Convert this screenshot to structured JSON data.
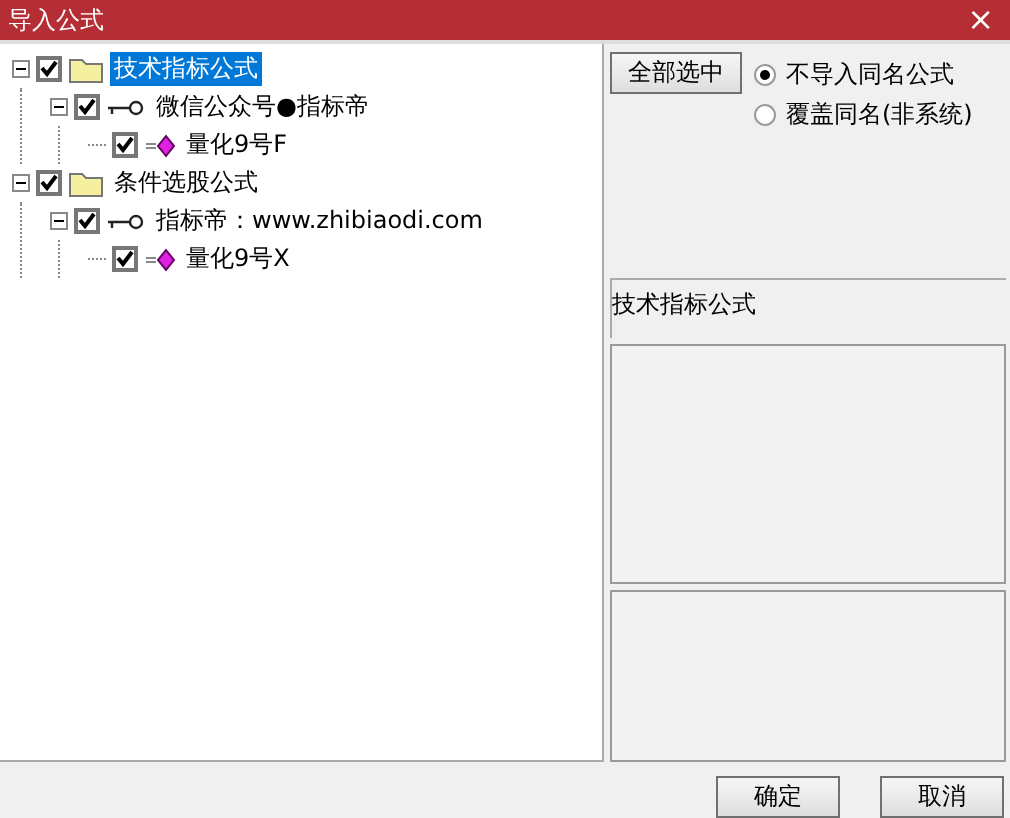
{
  "window": {
    "title": "导入公式",
    "close": "×"
  },
  "tree": [
    {
      "label": "技术指标公式",
      "kind": "folder",
      "checked": true,
      "selected": true,
      "expanded": true,
      "children": [
        {
          "label": "微信公众号●指标帝",
          "kind": "key",
          "checked": true,
          "selected": false,
          "expanded": true,
          "children": [
            {
              "label": "量化9号F",
              "kind": "formula",
              "checked": true,
              "selected": false
            }
          ]
        }
      ]
    },
    {
      "label": "条件选股公式",
      "kind": "folder",
      "checked": true,
      "selected": false,
      "expanded": true,
      "children": [
        {
          "label": "指标帝：www.zhibiaodi.com",
          "kind": "key",
          "checked": true,
          "selected": false,
          "expanded": true,
          "children": [
            {
              "label": "量化9号X",
              "kind": "formula",
              "checked": true,
              "selected": false
            }
          ]
        }
      ]
    }
  ],
  "select_all_button": "全部选中",
  "options": [
    {
      "label": "不导入同名公式",
      "selected": true
    },
    {
      "label": "覆盖同名(非系统)",
      "selected": false
    }
  ],
  "category_label": "技术指标公式",
  "buttons": [
    "确定",
    "取消"
  ]
}
